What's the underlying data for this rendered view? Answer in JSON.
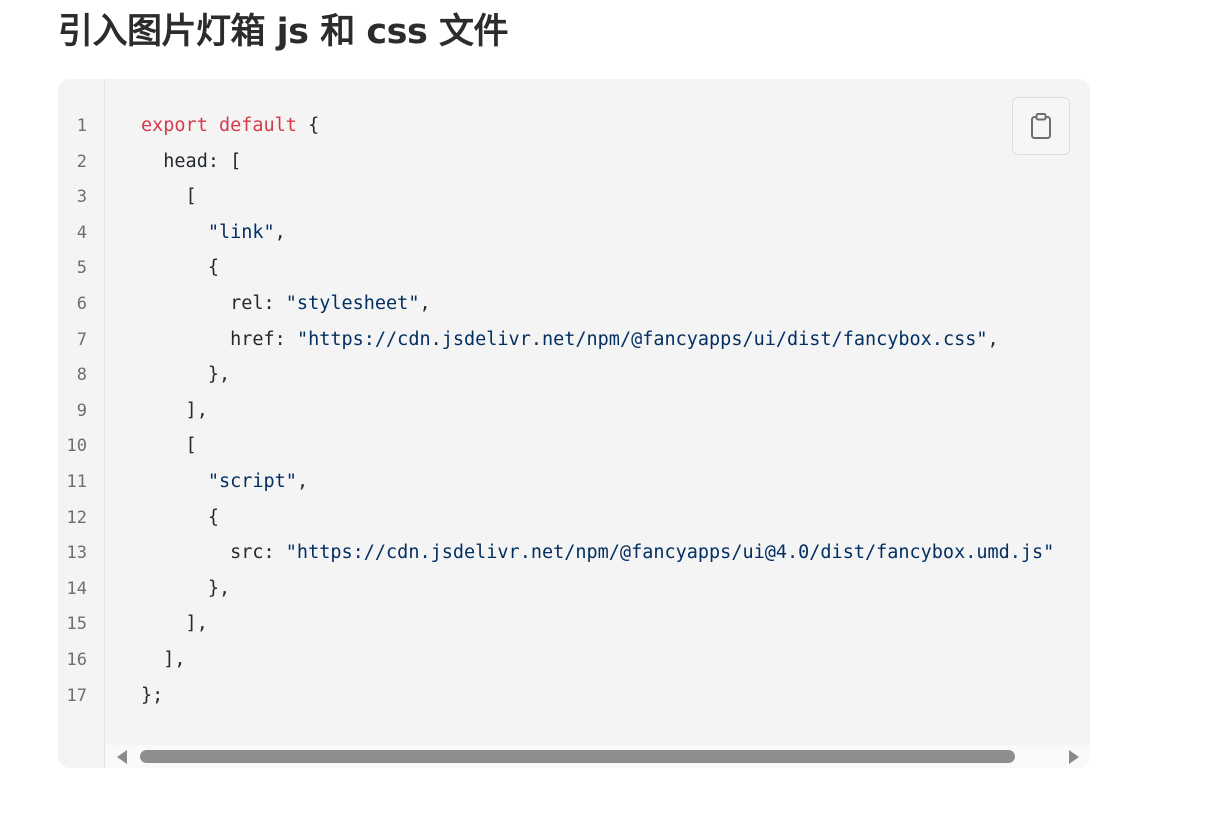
{
  "page": {
    "title": "引入图片灯箱 js 和 css 文件"
  },
  "code_block": {
    "language": "javascript",
    "copy_icon": "clipboard-icon",
    "line_numbers": [
      "1",
      "2",
      "3",
      "4",
      "5",
      "6",
      "7",
      "8",
      "9",
      "10",
      "11",
      "12",
      "13",
      "14",
      "15",
      "16",
      "17"
    ],
    "lines": [
      [
        {
          "t": "export default",
          "c": "kw"
        },
        {
          "t": " {",
          "c": "pl"
        }
      ],
      [
        {
          "t": "  head: [",
          "c": "pl"
        }
      ],
      [
        {
          "t": "    [",
          "c": "pl"
        }
      ],
      [
        {
          "t": "      ",
          "c": "pl"
        },
        {
          "t": "\"link\"",
          "c": "str"
        },
        {
          "t": ",",
          "c": "pl"
        }
      ],
      [
        {
          "t": "      {",
          "c": "pl"
        }
      ],
      [
        {
          "t": "        rel: ",
          "c": "pl"
        },
        {
          "t": "\"stylesheet\"",
          "c": "str"
        },
        {
          "t": ",",
          "c": "pl"
        }
      ],
      [
        {
          "t": "        href: ",
          "c": "pl"
        },
        {
          "t": "\"https://cdn.jsdelivr.net/npm/@fancyapps/ui/dist/fancybox.css\"",
          "c": "str"
        },
        {
          "t": ",",
          "c": "pl"
        }
      ],
      [
        {
          "t": "      },",
          "c": "pl"
        }
      ],
      [
        {
          "t": "    ],",
          "c": "pl"
        }
      ],
      [
        {
          "t": "    [",
          "c": "pl"
        }
      ],
      [
        {
          "t": "      ",
          "c": "pl"
        },
        {
          "t": "\"script\"",
          "c": "str"
        },
        {
          "t": ",",
          "c": "pl"
        }
      ],
      [
        {
          "t": "      {",
          "c": "pl"
        }
      ],
      [
        {
          "t": "        src: ",
          "c": "pl"
        },
        {
          "t": "\"https://cdn.jsdelivr.net/npm/@fancyapps/ui@4.0/dist/fancybox.umd.js\"",
          "c": "str"
        }
      ],
      [
        {
          "t": "      },",
          "c": "pl"
        }
      ],
      [
        {
          "t": "    ],",
          "c": "pl"
        }
      ],
      [
        {
          "t": "  ],",
          "c": "pl"
        }
      ],
      [
        {
          "t": "};",
          "c": "pl"
        }
      ]
    ]
  },
  "colors": {
    "keyword": "#d73a49",
    "string": "#032f62",
    "plain": "#24292e",
    "code_background": "#f4f4f4",
    "line_number": "#6e6e6e"
  }
}
